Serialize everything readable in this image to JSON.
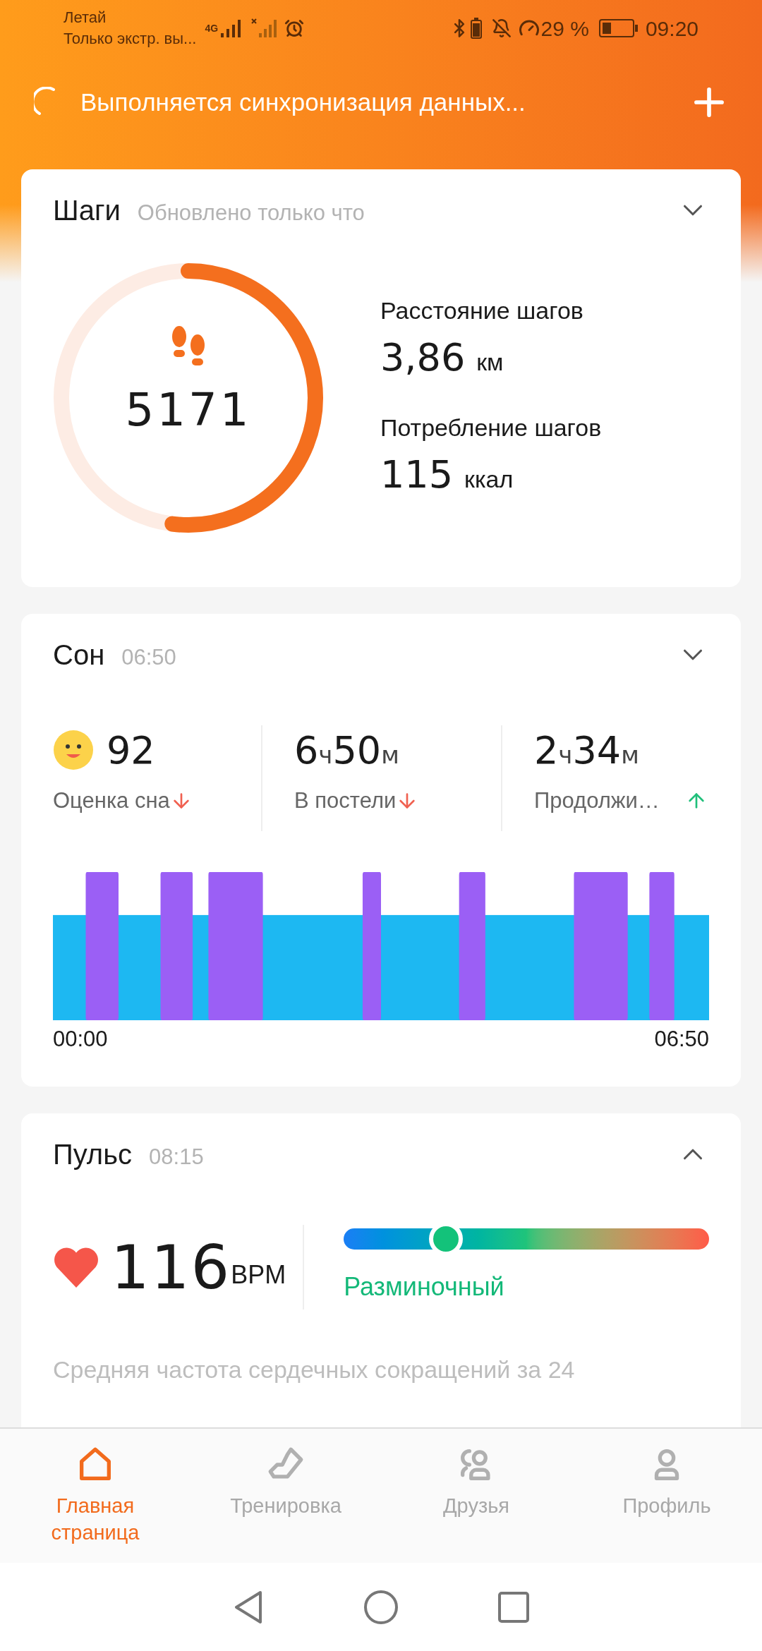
{
  "status_bar": {
    "carrier": "Летай",
    "carrier_mode": "Только экстр. вы...",
    "network": "4G",
    "battery_percent": "29 %",
    "time": "09:20"
  },
  "sync": {
    "message": "Выполняется синхронизация данных..."
  },
  "steps": {
    "title": "Шаги",
    "updated": "Обновлено только что",
    "expanded": false,
    "count": "5171",
    "level": 0.52,
    "metrics": [
      {
        "label": "Расстояние шагов",
        "value": "3,86",
        "unit": "км"
      },
      {
        "label": "Потребление шагов",
        "value": "115",
        "unit": "ккал"
      }
    ]
  },
  "sleep": {
    "title": "Сон",
    "time": "06:50",
    "expanded": false,
    "stats": [
      {
        "kind": "score",
        "value": "92",
        "label": "Оценка сна",
        "rising": false
      },
      {
        "kind": "duration",
        "hours": "6",
        "hours_unit": "ч",
        "minutes": "50",
        "minutes_unit": "м",
        "label": "В постели",
        "rising": false
      },
      {
        "kind": "duration",
        "hours": "2",
        "hours_unit": "ч",
        "minutes": "34",
        "minutes_unit": "м",
        "label": "Продолжи…",
        "rising": true
      }
    ],
    "chart_start": "00:00",
    "chart_end": "06:50"
  },
  "pulse": {
    "title": "Пульс",
    "time": "08:15",
    "expanded": true,
    "value": "116",
    "unit": "BPM",
    "level": 0.28,
    "zone": "Разминочный",
    "average_text": "Средняя частота сердечных сокращений за 24"
  },
  "nav": [
    {
      "label": "Главная страница",
      "kind": "home",
      "selected": true
    },
    {
      "label": "Тренировка",
      "kind": "workout",
      "selected": false
    },
    {
      "label": "Друзья",
      "kind": "friends",
      "selected": false
    },
    {
      "label": "Профиль",
      "kind": "profile",
      "selected": false
    }
  ]
}
